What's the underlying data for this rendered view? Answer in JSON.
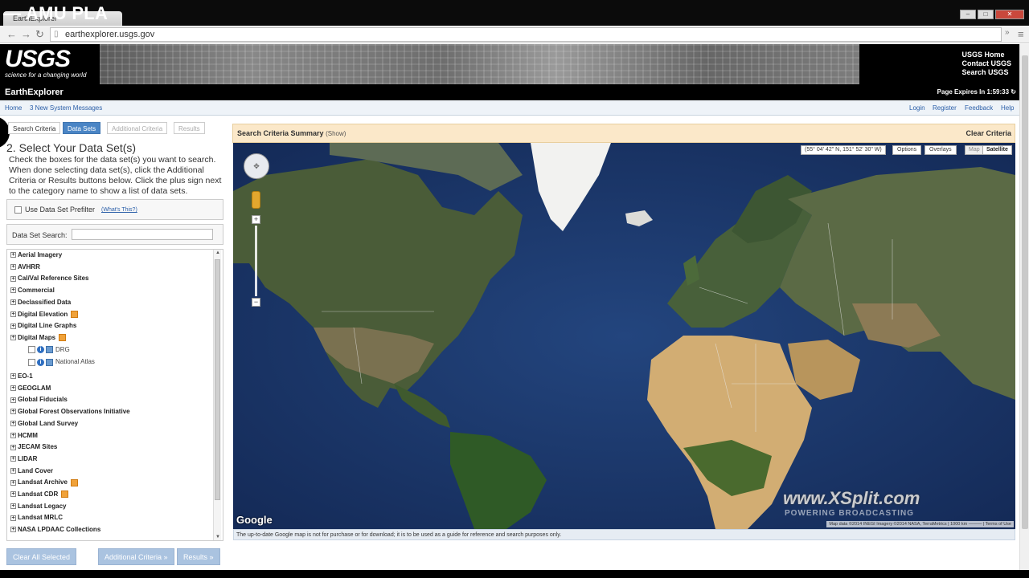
{
  "window": {
    "overlay_title": "AMU PLA",
    "tab_label": "EarthExplorer"
  },
  "browser": {
    "url": "earthexplorer.usgs.gov",
    "back_icon": "back-arrow-icon",
    "forward_icon": "forward-arrow-icon",
    "reload_icon": "reload-icon",
    "menu_icon": "menu-icon"
  },
  "header": {
    "logo": "USGS",
    "tagline": "science for a changing world",
    "links": [
      "USGS Home",
      "Contact USGS",
      "Search USGS"
    ]
  },
  "app_bar": {
    "title": "EarthExplorer",
    "expires": "Page Expires In 1:59:33"
  },
  "sub_nav": {
    "left": [
      "Home",
      "3 New System Messages"
    ],
    "right": [
      "Login",
      "Register",
      "Feedback",
      "Help"
    ]
  },
  "left_panel": {
    "tabs": [
      "Search Criteria",
      "Data Sets",
      "Additional Criteria",
      "Results"
    ],
    "title": "2. Select Your Data Set(s)",
    "instructions": "Check the boxes for the data set(s) you want to search. When done selecting data set(s), click the Additional Criteria or Results buttons below. Click the plus sign next to the category name to show a list of data sets.",
    "prefilter_label": "Use Data Set Prefilter",
    "whats_this": "(What's This?)",
    "search_label": "Data Set Search:",
    "search_value": "",
    "tree": [
      {
        "label": "Aerial Imagery",
        "badge": false
      },
      {
        "label": "AVHRR",
        "badge": false
      },
      {
        "label": "Cal/Val Reference Sites",
        "badge": false
      },
      {
        "label": "Commercial",
        "badge": false
      },
      {
        "label": "Declassified Data",
        "badge": false
      },
      {
        "label": "Digital Elevation",
        "badge": true
      },
      {
        "label": "Digital Line Graphs",
        "badge": false
      },
      {
        "label": "Digital Maps",
        "badge": true
      }
    ],
    "tree_sub": [
      "DRG",
      "National Atlas"
    ],
    "tree_after": [
      {
        "label": "EO-1",
        "badge": false
      },
      {
        "label": "GEOGLAM",
        "badge": false
      },
      {
        "label": "Global Fiducials",
        "badge": false
      },
      {
        "label": "Global Forest Observations Initiative",
        "badge": false
      },
      {
        "label": "Global Land Survey",
        "badge": false
      },
      {
        "label": "HCMM",
        "badge": false
      },
      {
        "label": "JECAM Sites",
        "badge": false
      },
      {
        "label": "LIDAR",
        "badge": false
      },
      {
        "label": "Land Cover",
        "badge": false
      },
      {
        "label": "Landsat Archive",
        "badge": true
      },
      {
        "label": "Landsat CDR",
        "badge": true
      },
      {
        "label": "Landsat Legacy",
        "badge": false
      },
      {
        "label": "Landsat MRLC",
        "badge": false
      },
      {
        "label": "NASA LPDAAC Collections",
        "badge": false
      }
    ],
    "buttons": [
      "Clear All Selected",
      "Additional Criteria »",
      "Results »"
    ]
  },
  "summary": {
    "title": "Search Criteria Summary",
    "show": "(Show)",
    "clear": "Clear Criteria"
  },
  "map": {
    "coords": "(55° 04' 42\" N, 151° 52' 30\" W)",
    "options": "Options",
    "overlays": "Overlays",
    "type_map": "Map",
    "type_satellite": "Satellite",
    "google": "Google",
    "watermark": "www.XSplit.com",
    "watermark_sub": "POWERING BROADCASTING",
    "attribution": "Map data ©2014 INEGI Imagery ©2014 NASA, TerraMetrics | 1000 km ——— | Terms of Use",
    "disclaimer": "The up-to-date Google map is not for purchase or for download; it is to be used as a guide for reference and search purposes only."
  }
}
